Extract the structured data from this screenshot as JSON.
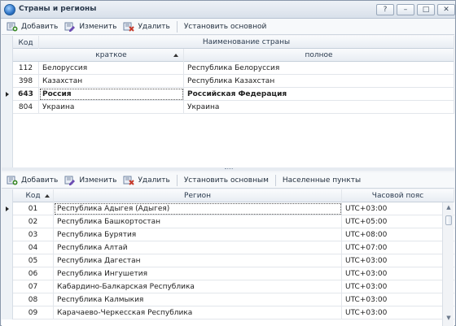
{
  "window": {
    "title": "Страны и регионы",
    "buttons": {
      "help": "?",
      "minimize": "–",
      "maximize": "□",
      "close": "✕"
    }
  },
  "top_toolbar": {
    "add": "Добавить",
    "edit": "Изменить",
    "delete": "Удалить",
    "set_default": "Установить основной"
  },
  "countries": {
    "headers": {
      "code": "Код",
      "name_group": "Наименование страны",
      "short": "краткое",
      "full": "полное"
    },
    "rows": [
      {
        "code": "112",
        "short": "Белоруссия",
        "full": "Республика Белоруссия",
        "selected": false
      },
      {
        "code": "398",
        "short": "Казахстан",
        "full": "Республика Казахстан",
        "selected": false
      },
      {
        "code": "643",
        "short": "Россия",
        "full": "Российская Федерация",
        "selected": true
      },
      {
        "code": "804",
        "short": "Украина",
        "full": "Украина",
        "selected": false
      }
    ]
  },
  "bottom_toolbar": {
    "add": "Добавить",
    "edit": "Изменить",
    "delete": "Удалить",
    "set_default": "Установить основным",
    "localities": "Населенные пункты"
  },
  "regions": {
    "headers": {
      "code": "Код",
      "region": "Регион",
      "timezone": "Часовой пояс"
    },
    "rows": [
      {
        "code": "01",
        "region": "Республика Адыгея (Адыгея)",
        "tz": "UTC+03:00"
      },
      {
        "code": "02",
        "region": "Республика Башкортостан",
        "tz": "UTC+05:00"
      },
      {
        "code": "03",
        "region": "Республика Бурятия",
        "tz": "UTC+08:00"
      },
      {
        "code": "04",
        "region": "Республика Алтай",
        "tz": "UTC+07:00"
      },
      {
        "code": "05",
        "region": "Республика Дагестан",
        "tz": "UTC+03:00"
      },
      {
        "code": "06",
        "region": "Республика Ингушетия",
        "tz": "UTC+03:00"
      },
      {
        "code": "07",
        "region": "Кабардино-Балкарская Республика",
        "tz": "UTC+03:00"
      },
      {
        "code": "08",
        "region": "Республика Калмыкия",
        "tz": "UTC+03:00"
      },
      {
        "code": "09",
        "region": "Карачаево-Черкесская Республика",
        "tz": "UTC+03:00"
      }
    ]
  },
  "icons": {
    "add": "add-icon",
    "edit": "edit-icon",
    "delete": "delete-icon"
  },
  "colors": {
    "add": "#3d8b2b",
    "edit": "#6d4db3",
    "delete": "#c63a2b"
  }
}
